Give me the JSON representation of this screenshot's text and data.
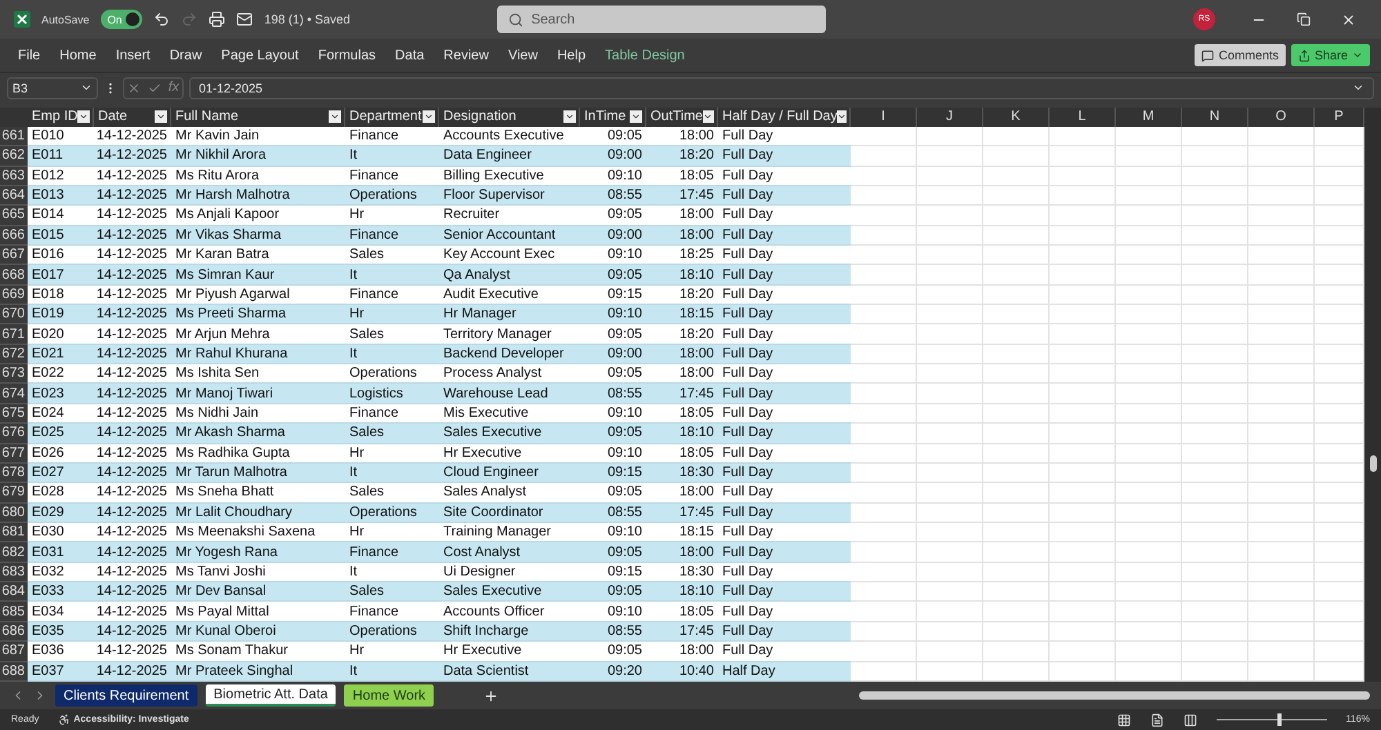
{
  "title_bar": {
    "autosave_label": "AutoSave",
    "autosave_toggle": {
      "label": "On",
      "on": true
    },
    "file_title": "198 (1) • Saved",
    "search": {
      "placeholder": "Search"
    },
    "avatar": "RS"
  },
  "ribbon_tabs": [
    {
      "label": "File",
      "kind": "plain"
    },
    {
      "label": "Home",
      "kind": "plain"
    },
    {
      "label": "Insert",
      "kind": "plain"
    },
    {
      "label": "Draw",
      "kind": "plain"
    },
    {
      "label": "Page Layout",
      "kind": "plain"
    },
    {
      "label": "Formulas",
      "kind": "plain"
    },
    {
      "label": "Data",
      "kind": "plain"
    },
    {
      "label": "Review",
      "kind": "plain"
    },
    {
      "label": "View",
      "kind": "plain"
    },
    {
      "label": "Help",
      "kind": "plain"
    },
    {
      "label": "Table Design",
      "kind": "contextual"
    }
  ],
  "ribbon_buttons": {
    "comments": "Comments",
    "share": "Share"
  },
  "formula_bar": {
    "name_box": "B3",
    "function_label": "fx",
    "value": "01-12-2025"
  },
  "table": {
    "columns": [
      "Emp ID",
      "Date",
      "Full Name",
      "Department",
      "Designation",
      "InTime",
      "OutTime",
      "Half Day / Full Day"
    ],
    "extra_columns": [
      "I",
      "J",
      "K",
      "L",
      "M",
      "N",
      "O",
      "P"
    ],
    "rows": [
      {
        "row": "661",
        "cells": [
          "E010",
          "14-12-2025",
          "Mr Kavin Jain",
          "Finance",
          "Accounts Executive",
          "09:05",
          "18:00",
          "Full Day"
        ]
      },
      {
        "row": "662",
        "cells": [
          "E011",
          "14-12-2025",
          "Mr Nikhil Arora",
          "It",
          "Data Engineer",
          "09:00",
          "18:20",
          "Full Day"
        ]
      },
      {
        "row": "663",
        "cells": [
          "E012",
          "14-12-2025",
          "Ms Ritu Arora",
          "Finance",
          "Billing Executive",
          "09:10",
          "18:05",
          "Full Day"
        ]
      },
      {
        "row": "664",
        "cells": [
          "E013",
          "14-12-2025",
          "Mr Harsh Malhotra",
          "Operations",
          "Floor Supervisor",
          "08:55",
          "17:45",
          "Full Day"
        ]
      },
      {
        "row": "665",
        "cells": [
          "E014",
          "14-12-2025",
          "Ms Anjali Kapoor",
          "Hr",
          "Recruiter",
          "09:05",
          "18:00",
          "Full Day"
        ]
      },
      {
        "row": "666",
        "cells": [
          "E015",
          "14-12-2025",
          "Mr Vikas Sharma",
          "Finance",
          "Senior Accountant",
          "09:00",
          "18:00",
          "Full Day"
        ]
      },
      {
        "row": "667",
        "cells": [
          "E016",
          "14-12-2025",
          "Mr Karan Batra",
          "Sales",
          "Key Account Exec",
          "09:10",
          "18:25",
          "Full Day"
        ]
      },
      {
        "row": "668",
        "cells": [
          "E017",
          "14-12-2025",
          "Ms Simran Kaur",
          "It",
          "Qa Analyst",
          "09:05",
          "18:10",
          "Full Day"
        ]
      },
      {
        "row": "669",
        "cells": [
          "E018",
          "14-12-2025",
          "Mr Piyush Agarwal",
          "Finance",
          "Audit Executive",
          "09:15",
          "18:20",
          "Full Day"
        ]
      },
      {
        "row": "670",
        "cells": [
          "E019",
          "14-12-2025",
          "Ms Preeti Sharma",
          "Hr",
          "Hr Manager",
          "09:10",
          "18:15",
          "Full Day"
        ]
      },
      {
        "row": "671",
        "cells": [
          "E020",
          "14-12-2025",
          "Mr Arjun Mehra",
          "Sales",
          "Territory Manager",
          "09:05",
          "18:20",
          "Full Day"
        ]
      },
      {
        "row": "672",
        "cells": [
          "E021",
          "14-12-2025",
          "Mr Rahul Khurana",
          "It",
          "Backend Developer",
          "09:00",
          "18:00",
          "Full Day"
        ]
      },
      {
        "row": "673",
        "cells": [
          "E022",
          "14-12-2025",
          "Ms Ishita Sen",
          "Operations",
          "Process Analyst",
          "09:05",
          "18:00",
          "Full Day"
        ]
      },
      {
        "row": "674",
        "cells": [
          "E023",
          "14-12-2025",
          "Mr Manoj Tiwari",
          "Logistics",
          "Warehouse Lead",
          "08:55",
          "17:45",
          "Full Day"
        ]
      },
      {
        "row": "675",
        "cells": [
          "E024",
          "14-12-2025",
          "Ms Nidhi Jain",
          "Finance",
          "Mis Executive",
          "09:10",
          "18:05",
          "Full Day"
        ]
      },
      {
        "row": "676",
        "cells": [
          "E025",
          "14-12-2025",
          "Mr Akash Sharma",
          "Sales",
          "Sales Executive",
          "09:05",
          "18:10",
          "Full Day"
        ]
      },
      {
        "row": "677",
        "cells": [
          "E026",
          "14-12-2025",
          "Ms Radhika Gupta",
          "Hr",
          "Hr Executive",
          "09:10",
          "18:05",
          "Full Day"
        ]
      },
      {
        "row": "678",
        "cells": [
          "E027",
          "14-12-2025",
          "Mr Tarun Malhotra",
          "It",
          "Cloud Engineer",
          "09:15",
          "18:30",
          "Full Day"
        ]
      },
      {
        "row": "679",
        "cells": [
          "E028",
          "14-12-2025",
          "Ms Sneha Bhatt",
          "Sales",
          "Sales Analyst",
          "09:05",
          "18:00",
          "Full Day"
        ]
      },
      {
        "row": "680",
        "cells": [
          "E029",
          "14-12-2025",
          "Mr Lalit Choudhary",
          "Operations",
          "Site Coordinator",
          "08:55",
          "17:45",
          "Full Day"
        ]
      },
      {
        "row": "681",
        "cells": [
          "E030",
          "14-12-2025",
          "Ms Meenakshi Saxena",
          "Hr",
          "Training Manager",
          "09:10",
          "18:15",
          "Full Day"
        ]
      },
      {
        "row": "682",
        "cells": [
          "E031",
          "14-12-2025",
          "Mr Yogesh Rana",
          "Finance",
          "Cost Analyst",
          "09:05",
          "18:00",
          "Full Day"
        ]
      },
      {
        "row": "683",
        "cells": [
          "E032",
          "14-12-2025",
          "Ms Tanvi Joshi",
          "It",
          "Ui Designer",
          "09:15",
          "18:30",
          "Full Day"
        ]
      },
      {
        "row": "684",
        "cells": [
          "E033",
          "14-12-2025",
          "Mr Dev Bansal",
          "Sales",
          "Sales Executive",
          "09:05",
          "18:10",
          "Full Day"
        ]
      },
      {
        "row": "685",
        "cells": [
          "E034",
          "14-12-2025",
          "Ms Payal Mittal",
          "Finance",
          "Accounts Officer",
          "09:10",
          "18:05",
          "Full Day"
        ]
      },
      {
        "row": "686",
        "cells": [
          "E035",
          "14-12-2025",
          "Mr Kunal Oberoi",
          "Operations",
          "Shift Incharge",
          "08:55",
          "17:45",
          "Full Day"
        ]
      },
      {
        "row": "687",
        "cells": [
          "E036",
          "14-12-2025",
          "Ms Sonam Thakur",
          "Hr",
          "Hr Executive",
          "09:05",
          "18:00",
          "Full Day"
        ]
      },
      {
        "row": "688",
        "cells": [
          "E037",
          "14-12-2025",
          "Mr Prateek Singhal",
          "It",
          "Data Scientist",
          "09:20",
          "10:40",
          "Half Day"
        ]
      }
    ]
  },
  "sheet_tabs": [
    {
      "label": "Clients Requirement",
      "selected": false,
      "color": "#0e2a6b"
    },
    {
      "label": "Biometric Att. Data",
      "selected": true,
      "color": "#ffffff"
    },
    {
      "label": "Home Work",
      "selected": false,
      "color": "#8fd14f"
    }
  ],
  "status_bar": {
    "status": "Ready",
    "accessibility": "Accessibility: Investigate",
    "zoom_slider": {
      "level": 0.55
    },
    "zoom": "116%"
  }
}
